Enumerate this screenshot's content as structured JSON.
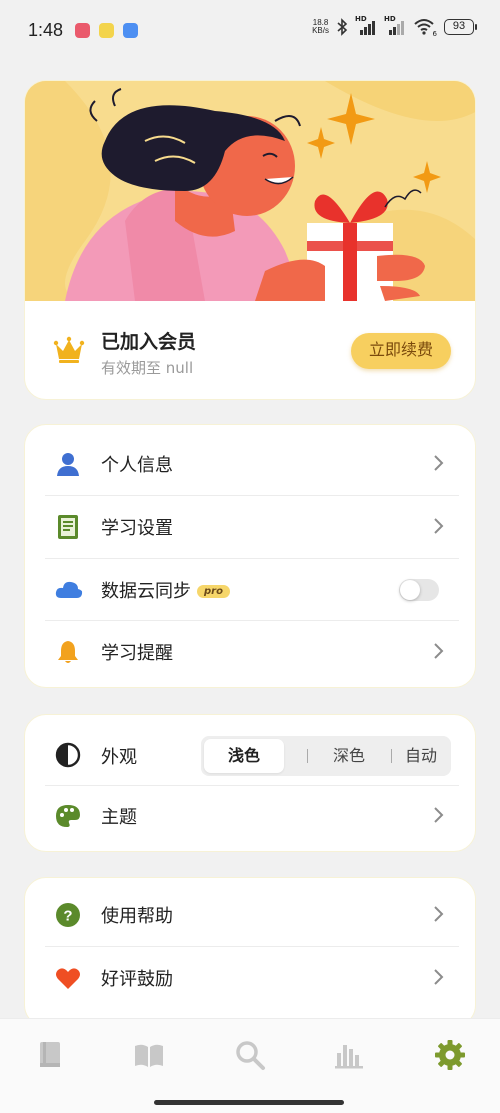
{
  "status_bar": {
    "time": "1:48",
    "net_speed_value": "18.8",
    "net_speed_unit": "KB/s",
    "signal_tag_1": "HD",
    "signal_tag_2": "HD",
    "wifi_tag": "6",
    "battery": "93"
  },
  "membership": {
    "title": "已加入会员",
    "expiry": "有效期至 null",
    "renew_label": "立即续费"
  },
  "menu_main": [
    {
      "label": "个人信息",
      "icon": "person-icon"
    },
    {
      "label": "学习设置",
      "icon": "book-settings-icon"
    },
    {
      "label": "数据云同步",
      "icon": "cloud-icon",
      "badge": "pro",
      "toggle_on": false
    },
    {
      "label": "学习提醒",
      "icon": "bell-icon"
    }
  ],
  "appearance": {
    "label": "外观",
    "options": [
      "浅色",
      "深色",
      "自动"
    ],
    "selected": "浅色"
  },
  "theme": {
    "label": "主题",
    "icon": "palette-icon"
  },
  "menu_more": [
    {
      "label": "使用帮助",
      "icon": "help-icon"
    },
    {
      "label": "好评鼓励",
      "icon": "heart-icon"
    }
  ],
  "tabbar": [
    {
      "name": "wordbook-tab",
      "icon": "book-icon",
      "active": false
    },
    {
      "name": "reading-tab",
      "icon": "open-book-icon",
      "active": false
    },
    {
      "name": "search-tab",
      "icon": "search-icon",
      "active": false
    },
    {
      "name": "stats-tab",
      "icon": "bar-chart-icon",
      "active": false
    },
    {
      "name": "settings-tab",
      "icon": "gear-icon",
      "active": true
    }
  ],
  "colors": {
    "accent_gold": "#f7cf5f",
    "active_tab": "#7d9a2d",
    "person_icon": "#3f6fd1",
    "cloud_icon": "#3f7ee0",
    "bell_icon": "#f2a21e",
    "book_icon": "#5b8a2b",
    "heart_icon": "#ef4e23"
  }
}
